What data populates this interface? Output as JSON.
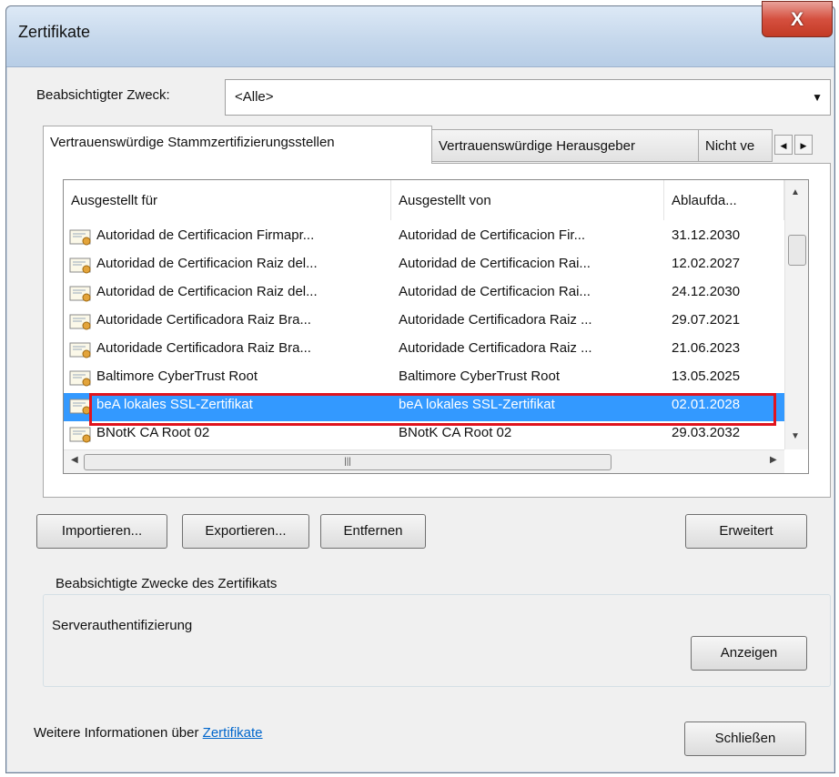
{
  "window": {
    "title": "Zertifikate",
    "close_label": "X"
  },
  "purpose": {
    "label": "Beabsichtigter Zweck:",
    "value": "<Alle>"
  },
  "tabs": [
    {
      "label": "Vertrauenswürdige Stammzertifizierungsstellen"
    },
    {
      "label": "Vertrauenswürdige Herausgeber"
    },
    {
      "label": "Nicht ve"
    }
  ],
  "table": {
    "columns": [
      "Ausgestellt für",
      "Ausgestellt von",
      "Ablaufda..."
    ],
    "rows": [
      {
        "issued_to": "Autoridad de Certificacion Firmapr...",
        "issued_by": "Autoridad de Certificacion Fir...",
        "expires": "31.12.2030"
      },
      {
        "issued_to": "Autoridad de Certificacion Raiz del...",
        "issued_by": "Autoridad de Certificacion Rai...",
        "expires": "12.02.2027"
      },
      {
        "issued_to": "Autoridad de Certificacion Raiz del...",
        "issued_by": "Autoridad de Certificacion Rai...",
        "expires": "24.12.2030"
      },
      {
        "issued_to": "Autoridade Certificadora Raiz Bra...",
        "issued_by": "Autoridade Certificadora Raiz ...",
        "expires": "29.07.2021"
      },
      {
        "issued_to": "Autoridade Certificadora Raiz Bra...",
        "issued_by": "Autoridade Certificadora Raiz ...",
        "expires": "21.06.2023"
      },
      {
        "issued_to": "Baltimore CyberTrust Root",
        "issued_by": "Baltimore CyberTrust Root",
        "expires": "13.05.2025"
      },
      {
        "issued_to": "beA lokales SSL-Zertifikat",
        "issued_by": "beA lokales SSL-Zertifikat",
        "expires": "02.01.2028"
      },
      {
        "issued_to": "BNotK CA Root 02",
        "issued_by": "BNotK CA Root 02",
        "expires": "29.03.2032"
      }
    ],
    "selected_index": 6
  },
  "buttons": {
    "import": "Importieren...",
    "export": "Exportieren...",
    "remove": "Entfernen",
    "advanced": "Erweitert",
    "view": "Anzeigen",
    "close": "Schließen"
  },
  "purposes_group": {
    "title": "Beabsichtigte Zwecke des Zertifikats",
    "value": "Serverauthentifizierung"
  },
  "footer": {
    "text": "Weitere Informationen über",
    "link": "Zertifikate"
  },
  "colors": {
    "selection": "#3399ff",
    "highlight_border": "#e0141e",
    "link": "#0066cc"
  }
}
